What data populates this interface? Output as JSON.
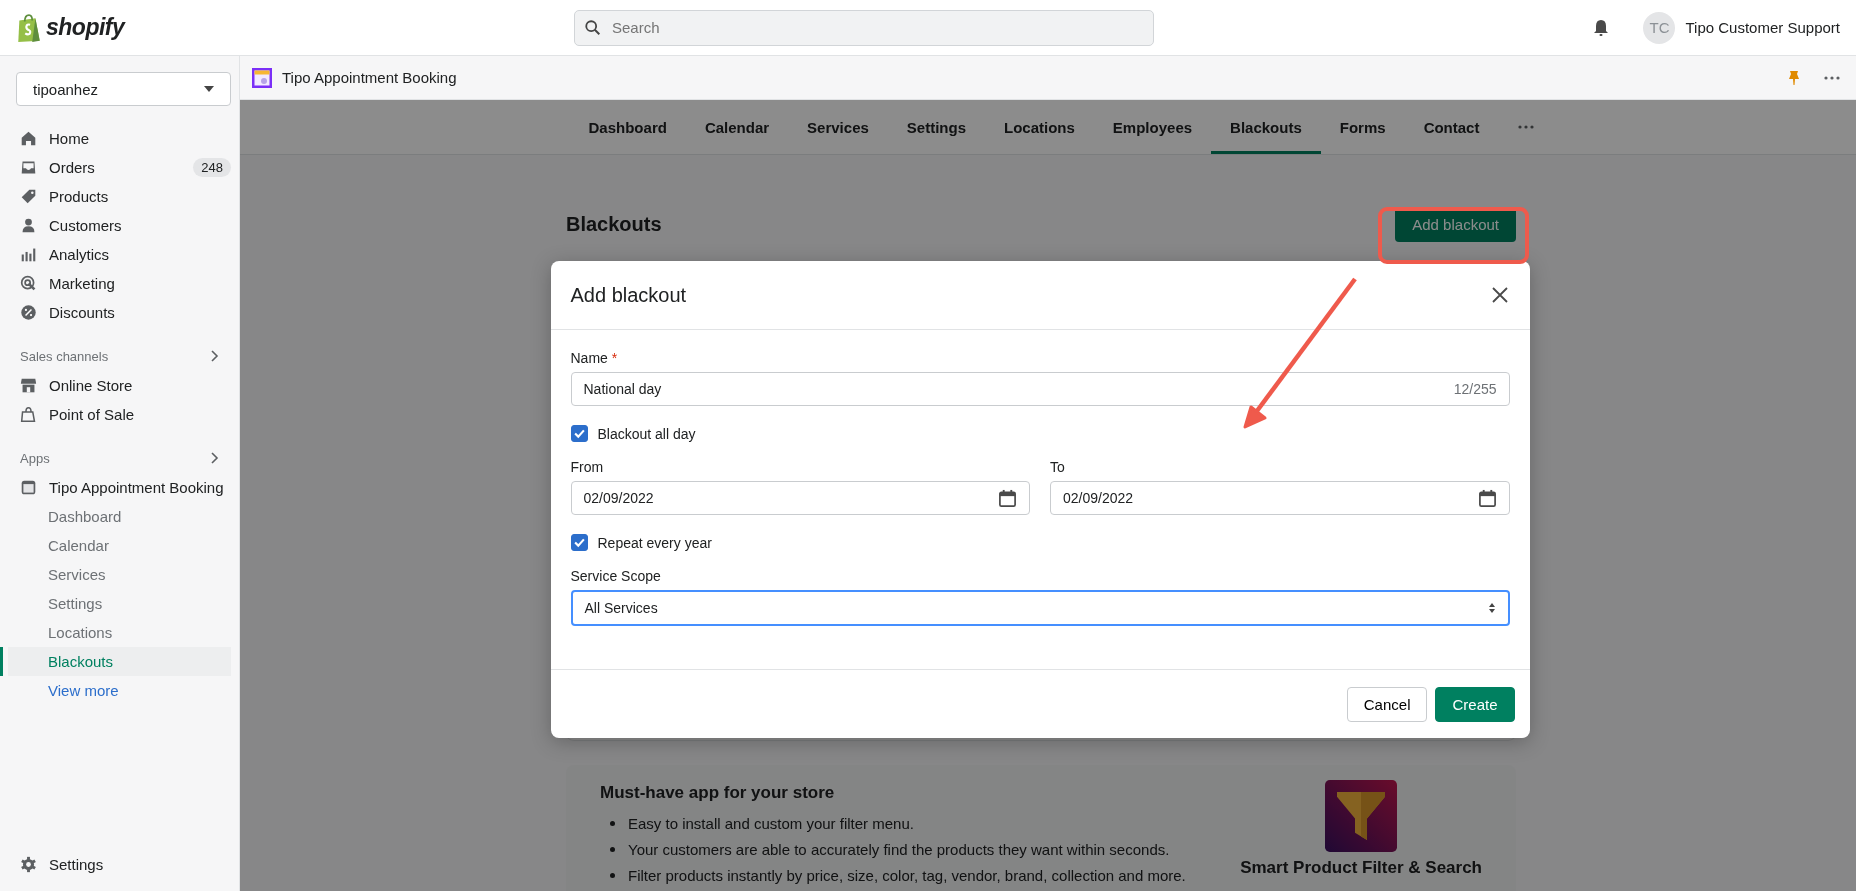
{
  "topbar": {
    "brand": "shopify",
    "search": {
      "placeholder": "Search"
    },
    "avatar": "TC",
    "user": "Tipo Customer Support"
  },
  "sidebar": {
    "store": "tipoanhez",
    "nav": [
      {
        "kind": "home",
        "label": "Home"
      },
      {
        "kind": "orders",
        "label": "Orders",
        "badge": "248"
      },
      {
        "kind": "products",
        "label": "Products"
      },
      {
        "kind": "customers",
        "label": "Customers"
      },
      {
        "kind": "analytics",
        "label": "Analytics"
      },
      {
        "kind": "marketing",
        "label": "Marketing"
      },
      {
        "kind": "discounts",
        "label": "Discounts"
      }
    ],
    "sales_channels": {
      "heading": "Sales channels",
      "items": [
        {
          "kind": "store",
          "label": "Online Store"
        },
        {
          "kind": "pos",
          "label": "Point of Sale"
        }
      ]
    },
    "apps": {
      "heading": "Apps",
      "app": "Tipo Appointment Booking",
      "children": [
        {
          "label": "Dashboard",
          "selected": false
        },
        {
          "label": "Calendar",
          "selected": false
        },
        {
          "label": "Services",
          "selected": false
        },
        {
          "label": "Settings",
          "selected": false
        },
        {
          "label": "Locations",
          "selected": false
        },
        {
          "label": "Blackouts",
          "selected": true
        }
      ],
      "more": "View more"
    },
    "settings": "Settings"
  },
  "app_bar": {
    "title": "Tipo Appointment Booking"
  },
  "tabs": [
    {
      "label": "Dashboard",
      "selected": false
    },
    {
      "label": "Calendar",
      "selected": false
    },
    {
      "label": "Services",
      "selected": false
    },
    {
      "label": "Settings",
      "selected": false
    },
    {
      "label": "Locations",
      "selected": false
    },
    {
      "label": "Employees",
      "selected": false
    },
    {
      "label": "Blackouts",
      "selected": true
    },
    {
      "label": "Forms",
      "selected": false
    },
    {
      "label": "Contact",
      "selected": false
    }
  ],
  "page": {
    "title": "Blackouts",
    "primary_action": "Add blackout"
  },
  "modal": {
    "title": "Add blackout",
    "name": {
      "label": "Name",
      "required_mark": "*",
      "value": "National day",
      "counter": "12/255"
    },
    "all_day": {
      "label": "Blackout all day",
      "checked": true
    },
    "from": {
      "label": "From",
      "value": "02/09/2022"
    },
    "to": {
      "label": "To",
      "value": "02/09/2022"
    },
    "repeat": {
      "label": "Repeat every year",
      "checked": true
    },
    "scope": {
      "label": "Service Scope",
      "value": "All Services",
      "focused": true
    },
    "cancel": "Cancel",
    "create": "Create"
  },
  "promo": {
    "title": "Must-have app for your store",
    "bullets": [
      "Easy to install and custom your filter menu.",
      "Your customers are able to accurately find the products they want within seconds.",
      "Filter products instantly by price, size, color, tag, vendor, brand, collection and more."
    ],
    "app_name": "Smart Product Filter & Search"
  }
}
